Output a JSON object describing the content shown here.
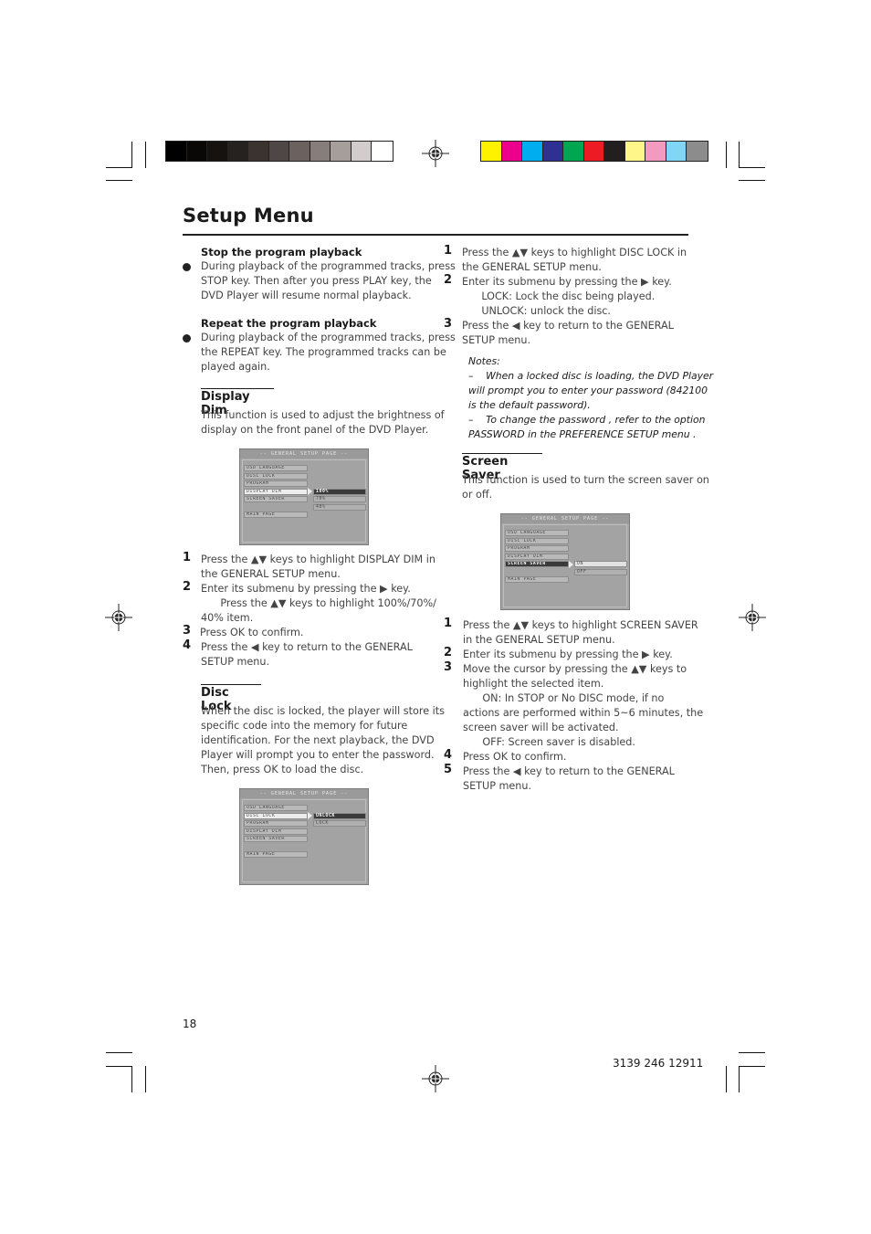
{
  "print_marks": {
    "grayscale_bar": [
      "#000000",
      "#0a0806",
      "#161210",
      "#262220",
      "#3a3330",
      "#4e4745",
      "#6b625f",
      "#877e7b",
      "#a69e9b",
      "#d3cccc",
      "#ffffff"
    ],
    "color_bar": [
      "#fff200",
      "#ec008c",
      "#00aeef",
      "#2e3192",
      "#00a651",
      "#ed1c24",
      "#231f20",
      "#fff689",
      "#f49ac1",
      "#7fd6f7",
      "#8c8c8c"
    ]
  },
  "page": {
    "title": "Setup Menu",
    "page_number": "18",
    "doc_code": "3139 246 12911"
  },
  "left": {
    "stop": {
      "heading": "Stop the program playback",
      "lines": [
        "During playback of the programmed tracks, press",
        "STOP key. Then after you press PLAY key, the",
        "DVD Player will resume normal playback."
      ]
    },
    "repeat": {
      "heading": "Repeat the program playback",
      "lines": [
        "During playback of the programmed tracks, press",
        "the REPEAT key. The programmed tracks can be",
        "played again."
      ]
    },
    "display_dim": {
      "heading": "Display Dim",
      "lines": [
        "This function is used to adjust the brightness of",
        "display on the front panel of the DVD Player."
      ],
      "steps": [
        {
          "num": "1",
          "lines": [
            "Press the ▲▼ keys to highlight  DISPLAY DIM in",
            "the GENERAL SETUP menu."
          ]
        },
        {
          "num": "2",
          "lines": [
            "Enter its submenu by pressing the ▶  key.",
            "      Press the ▲▼ keys to highlight 100%/70%/",
            "40% item."
          ]
        },
        {
          "num": "3",
          "lines": [
            "Press OK to confirm."
          ]
        },
        {
          "num": "4",
          "lines": [
            "Press the ◀ key to return to the GENERAL",
            "SETUP menu."
          ]
        }
      ]
    },
    "disc_lock": {
      "heading": "Disc Lock",
      "lines": [
        "When the disc is locked, the player will store its",
        "specific code into the memory for future",
        "identification. For the next playback, the DVD",
        "Player will prompt you to enter the password.",
        "Then, press OK to load the disc."
      ]
    }
  },
  "right": {
    "disc_lock_steps": [
      {
        "num": "1",
        "lines": [
          "Press the ▲▼ keys to highlight DISC LOCK in",
          "the GENERAL SETUP menu."
        ]
      },
      {
        "num": "2",
        "lines": [
          "Enter its submenu by pressing the ▶  key.",
          "      LOCK: Lock the disc being played.",
          "      UNLOCK: unlock the disc."
        ]
      },
      {
        "num": "3",
        "lines": [
          "Press the ◀ key to return to the GENERAL",
          "SETUP menu."
        ]
      }
    ],
    "notes": {
      "label": "Notes:",
      "lines": [
        "–    When a locked disc is loading, the DVD Player",
        "will prompt you to enter your password (842100",
        "is the default password).",
        "–    To change the password , refer to the option",
        "PASSWORD in the PREFERENCE SETUP menu ."
      ]
    },
    "screen_saver": {
      "heading": "Screen Saver",
      "lines": [
        "This function is used to turn the screen saver on",
        "or off."
      ],
      "steps": [
        {
          "num": "1",
          "lines": [
            "Press the ▲▼ keys to highlight SCREEN SAVER",
            "in the GENERAL SETUP menu."
          ]
        },
        {
          "num": "2",
          "lines": [
            "Enter its submenu by pressing the ▶ key."
          ]
        },
        {
          "num": "3",
          "lines": [
            "Move the cursor by pressing the ▲▼ keys to",
            "highlight the selected item.",
            "      ON: In STOP or No DISC mode, if no",
            "actions are performed within 5~6 minutes, the",
            "screen saver will be activated.",
            "      OFF: Screen saver is disabled."
          ]
        },
        {
          "num": "4",
          "lines": [
            "Press OK to confirm."
          ]
        },
        {
          "num": "5",
          "lines": [
            "Press the ◀ key to return to the GENERAL",
            "SETUP menu."
          ]
        }
      ]
    }
  },
  "osd": {
    "header": "-- GENERAL SETUP PAGE --",
    "items": [
      "OSD LANGUAGE",
      "DISC LOCK",
      "PROGRAM",
      "DISPLAY DIM",
      "SCREEN SAVER"
    ],
    "main_page": "MAIN PAGE",
    "display_dim_options": [
      "100%",
      "70%",
      "40%"
    ],
    "disc_lock_options": [
      "UNLOCK",
      "LOCK"
    ],
    "screen_saver_options": [
      "ON",
      "OFF"
    ]
  }
}
